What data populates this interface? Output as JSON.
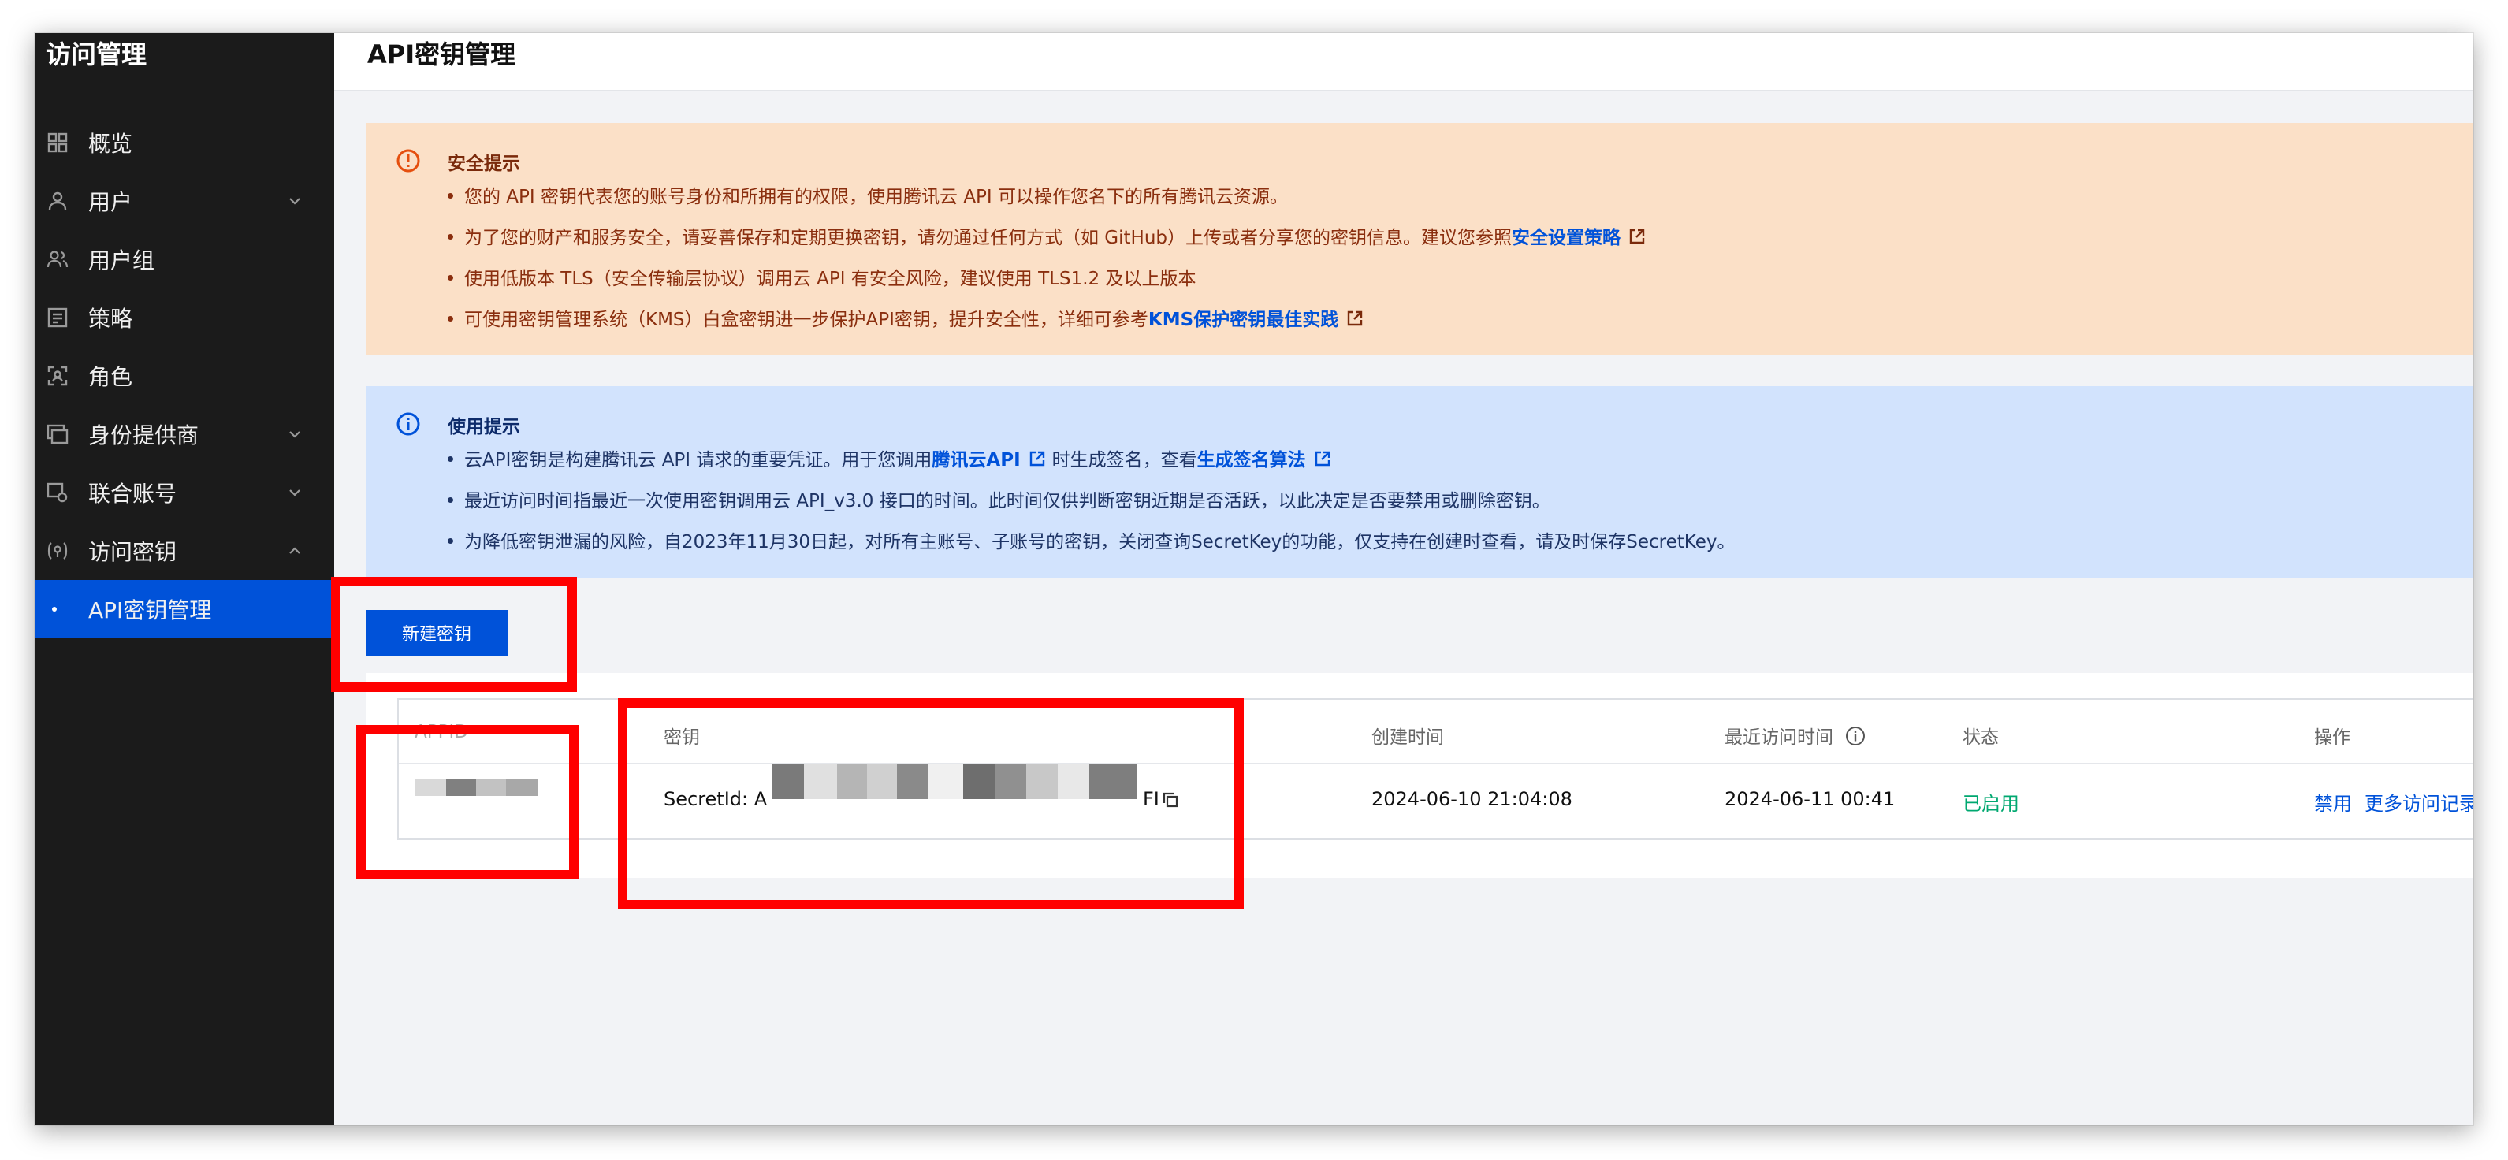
{
  "sidebar": {
    "title": "访问管理",
    "items": [
      {
        "label": "概览",
        "icon": "grid-icon",
        "chevron": false
      },
      {
        "label": "用户",
        "icon": "user-icon",
        "chevron": true
      },
      {
        "label": "用户组",
        "icon": "user-group-icon",
        "chevron": false
      },
      {
        "label": "策略",
        "icon": "policy-icon",
        "chevron": false
      },
      {
        "label": "角色",
        "icon": "role-icon",
        "chevron": false
      },
      {
        "label": "身份提供商",
        "icon": "identity-provider-icon",
        "chevron": true
      },
      {
        "label": "联合账号",
        "icon": "federated-account-icon",
        "chevron": true
      },
      {
        "label": "访问密钥",
        "icon": "access-key-icon",
        "chevron": true,
        "expanded": true
      }
    ],
    "active_sub_item": "API密钥管理"
  },
  "header": {
    "title": "API密钥管理"
  },
  "security_notice": {
    "title": "安全提示",
    "bullets": [
      {
        "text": "您的 API 密钥代表您的账号身份和所拥有的权限，使用腾讯云 API 可以操作您名下的所有腾讯云资源。"
      },
      {
        "text": "为了您的财产和服务安全，请妥善保存和定期更换密钥，请勿通过任何方式（如 GitHub）上传或者分享您的密钥信息。建议您参照",
        "link": "安全设置策略"
      },
      {
        "text": "使用低版本 TLS（安全传输层协议）调用云 API 有安全风险，建议使用 TLS1.2 及以上版本"
      },
      {
        "text": "可使用密钥管理系统（KMS）白盒密钥进一步保护API密钥，提升安全性，详细可参考",
        "link": "KMS保护密钥最佳实践"
      }
    ]
  },
  "usage_notice": {
    "title": "使用提示",
    "bullets": [
      {
        "text_a": "云API密钥是构建腾讯云 API 请求的重要凭证。用于您调用",
        "link_a": "腾讯云API",
        "text_b": "时生成签名，查看",
        "link_b": "生成签名算法"
      },
      {
        "text": "最近访问时间指最近一次使用密钥调用云 API_v3.0 接口的时间。此时间仅供判断密钥近期是否活跃，以此决定是否要禁用或删除密钥。"
      },
      {
        "text": "为降低密钥泄漏的风险，自2023年11月30日起，对所有主账号、子账号的密钥，关闭查询SecretKey的功能，仅支持在创建时查看，请及时保存SecretKey。"
      }
    ]
  },
  "actions": {
    "new_key_button": "新建密钥"
  },
  "table": {
    "columns": [
      "APPID",
      "密钥",
      "创建时间",
      "最近访问时间",
      "状态",
      "操作"
    ],
    "rows": [
      {
        "secret_prefix": "SecretId: A",
        "secret_suffix": "FI",
        "created_at": "2024-06-10 21:04:08",
        "last_access": "2024-06-11 00:41",
        "status": "已启用",
        "op_disable": "禁用",
        "op_more": "更多访问记录"
      }
    ]
  },
  "colors": {
    "accent": "#0052d9",
    "status_enabled": "#00a870",
    "warning_bg": "#fbe0c7",
    "info_bg": "#d2e3fd",
    "annotation_red": "#ff0000"
  }
}
